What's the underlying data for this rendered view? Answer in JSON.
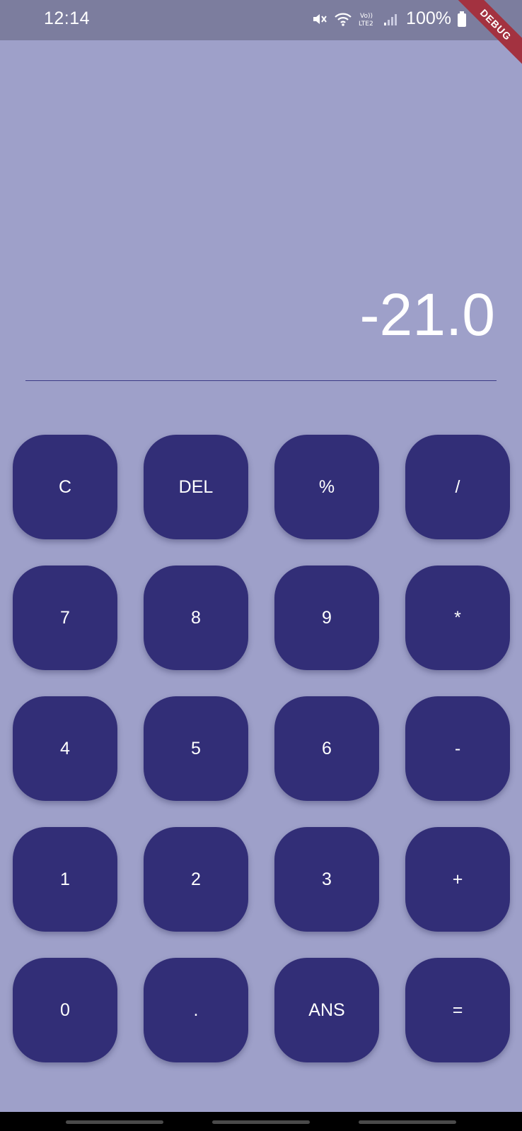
{
  "status_bar": {
    "time": "12:14",
    "signal_label": "Vo)) LTE2",
    "battery": "100%",
    "icons": [
      "mute-icon",
      "wifi-icon",
      "volte-icon",
      "cell-signal-icon",
      "battery-icon"
    ]
  },
  "debug_banner": "DEBUG",
  "display": {
    "value": "-21.0"
  },
  "keypad": {
    "keys": [
      {
        "label": "C",
        "name": "clear"
      },
      {
        "label": "DEL",
        "name": "delete"
      },
      {
        "label": "%",
        "name": "percent"
      },
      {
        "label": "/",
        "name": "divide"
      },
      {
        "label": "7",
        "name": "7"
      },
      {
        "label": "8",
        "name": "8"
      },
      {
        "label": "9",
        "name": "9"
      },
      {
        "label": "*",
        "name": "multiply"
      },
      {
        "label": "4",
        "name": "4"
      },
      {
        "label": "5",
        "name": "5"
      },
      {
        "label": "6",
        "name": "6"
      },
      {
        "label": "-",
        "name": "subtract"
      },
      {
        "label": "1",
        "name": "1"
      },
      {
        "label": "2",
        "name": "2"
      },
      {
        "label": "3",
        "name": "3"
      },
      {
        "label": "+",
        "name": "add"
      },
      {
        "label": "0",
        "name": "0"
      },
      {
        "label": ".",
        "name": "decimal"
      },
      {
        "label": "ANS",
        "name": "answer"
      },
      {
        "label": "=",
        "name": "equals"
      }
    ]
  },
  "colors": {
    "background": "#9ea0c9",
    "status_bar": "#7c7d9e",
    "key": "#322e77",
    "key_text": "#ffffff",
    "divider": "#3c3a86",
    "debug_banner": "#a33240"
  }
}
